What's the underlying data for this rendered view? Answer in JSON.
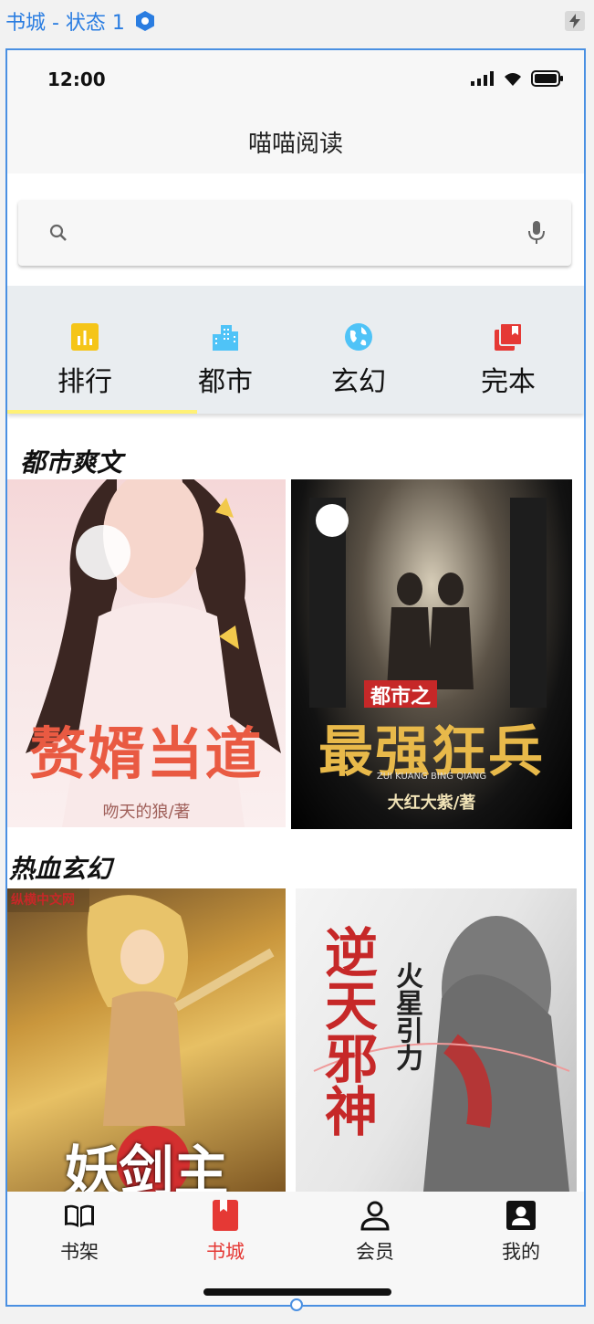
{
  "window": {
    "title": "书城 - 状态 1",
    "accent_color": "#2a7de1"
  },
  "status_bar": {
    "time": "12:00",
    "icons": [
      "signal-icon",
      "wifi-icon",
      "battery-icon"
    ]
  },
  "app_bar": {
    "title": "喵喵阅读"
  },
  "search": {
    "placeholder": "",
    "value": "",
    "icons": [
      "search-icon",
      "mic-icon"
    ]
  },
  "tabs": [
    {
      "label": "排行",
      "icon": "bar-chart-icon",
      "color": "#f5c518",
      "selected": true
    },
    {
      "label": "都市",
      "icon": "city-icon",
      "color": "#4fc3f7",
      "selected": false
    },
    {
      "label": "玄幻",
      "icon": "globe-icon",
      "color": "#4fc3f7",
      "selected": false
    },
    {
      "label": "完本",
      "icon": "library-books-icon",
      "color": "#e53935",
      "selected": false
    }
  ],
  "tab_indicator_color": "#fff176",
  "sections": [
    {
      "title": "都市爽文",
      "books": [
        {
          "cover_title": "赘婿当道",
          "author": "吻天的狼/著"
        },
        {
          "cover_title": "最强狂兵",
          "cover_subtitle": "都市之",
          "cover_pinyin": "ZUI KUANG BING QIANG",
          "author": "大红大紫/著"
        }
      ]
    },
    {
      "title": "热血玄幻",
      "books": [
        {
          "cover_title": "妖剑主",
          "publisher": "纵横中文网"
        },
        {
          "cover_title": "逆天邪神",
          "cover_subtitle": "火星引力"
        }
      ]
    }
  ],
  "bottom_nav": [
    {
      "label": "书架",
      "icon": "book-open-icon",
      "active": false
    },
    {
      "label": "书城",
      "icon": "bookmark-icon",
      "active": true
    },
    {
      "label": "会员",
      "icon": "person-icon",
      "active": false
    },
    {
      "label": "我的",
      "icon": "account-box-icon",
      "active": false
    }
  ],
  "active_color": "#e53935"
}
